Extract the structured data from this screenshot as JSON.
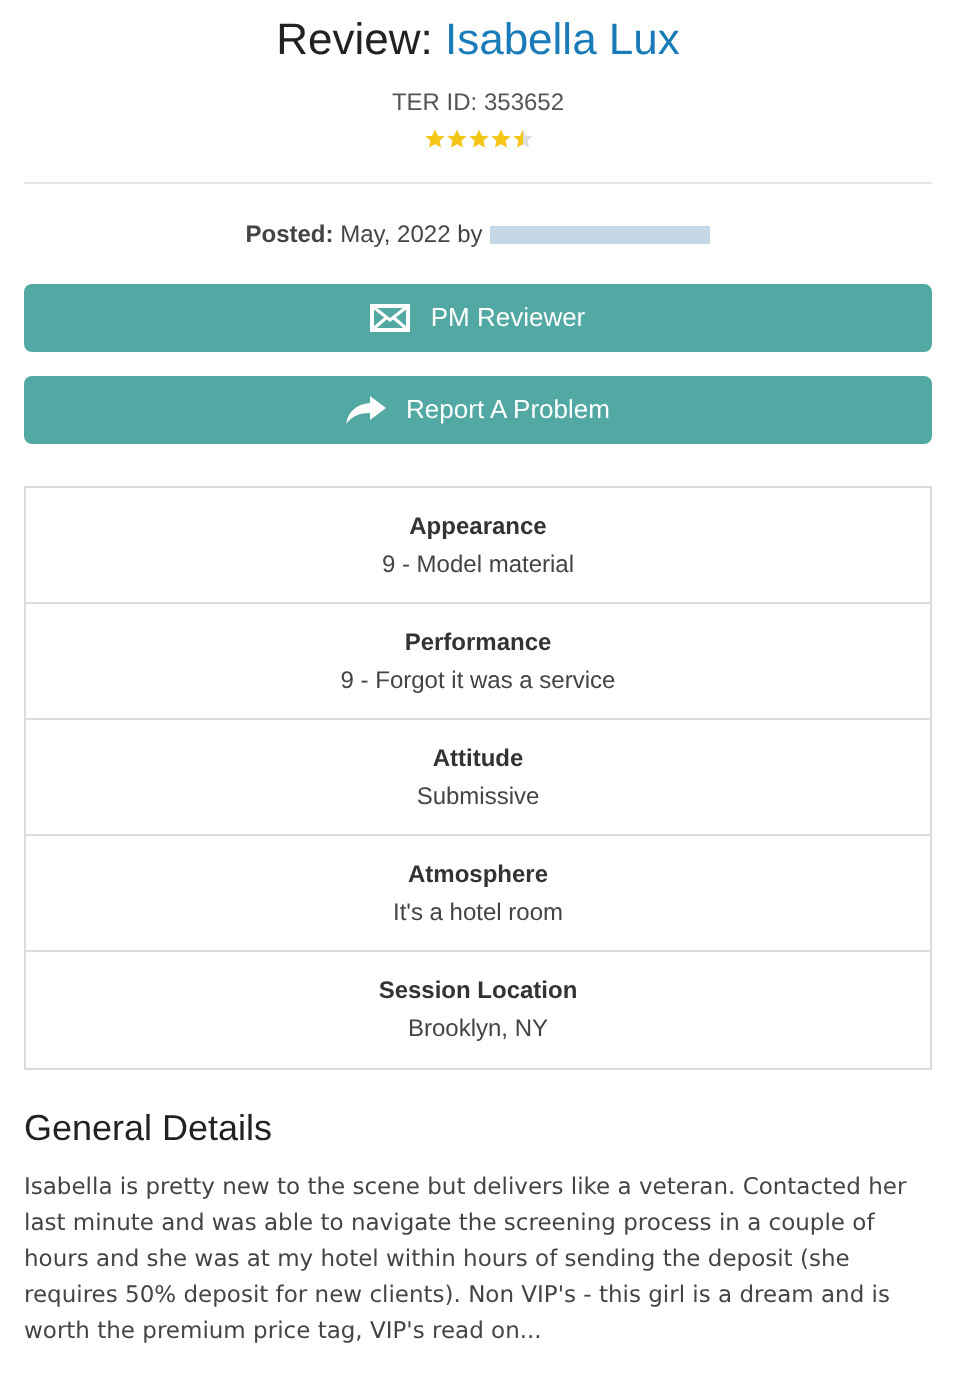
{
  "header": {
    "title_prefix": "Review:",
    "name": "Isabella Lux",
    "ter_id": "TER ID: 353652",
    "stars": 4.5
  },
  "posted": {
    "label": "Posted:",
    "text": "May, 2022 by",
    "author_redacted": true
  },
  "buttons": [
    {
      "kind": "mail",
      "label": "PM Reviewer"
    },
    {
      "kind": "share",
      "label": "Report A Problem"
    }
  ],
  "ratings": [
    {
      "label": "Appearance",
      "value": "9 - Model material"
    },
    {
      "label": "Performance",
      "value": "9 - Forgot it was a service"
    },
    {
      "label": "Attitude",
      "value": "Submissive"
    },
    {
      "label": "Atmosphere",
      "value": "It's a hotel room"
    },
    {
      "label": "Session Location",
      "value": "Brooklyn, NY"
    }
  ],
  "general_details": {
    "heading": "General Details",
    "text": "Isabella is pretty new to the scene but delivers like a veteran. Contacted her last minute and was able to navigate the screening process in a couple of hours and she was at my hotel within hours of sending the deposit (she requires 50% deposit for new clients). Non VIP's - this girl is a dream and is worth the premium price tag, VIP's read on..."
  }
}
